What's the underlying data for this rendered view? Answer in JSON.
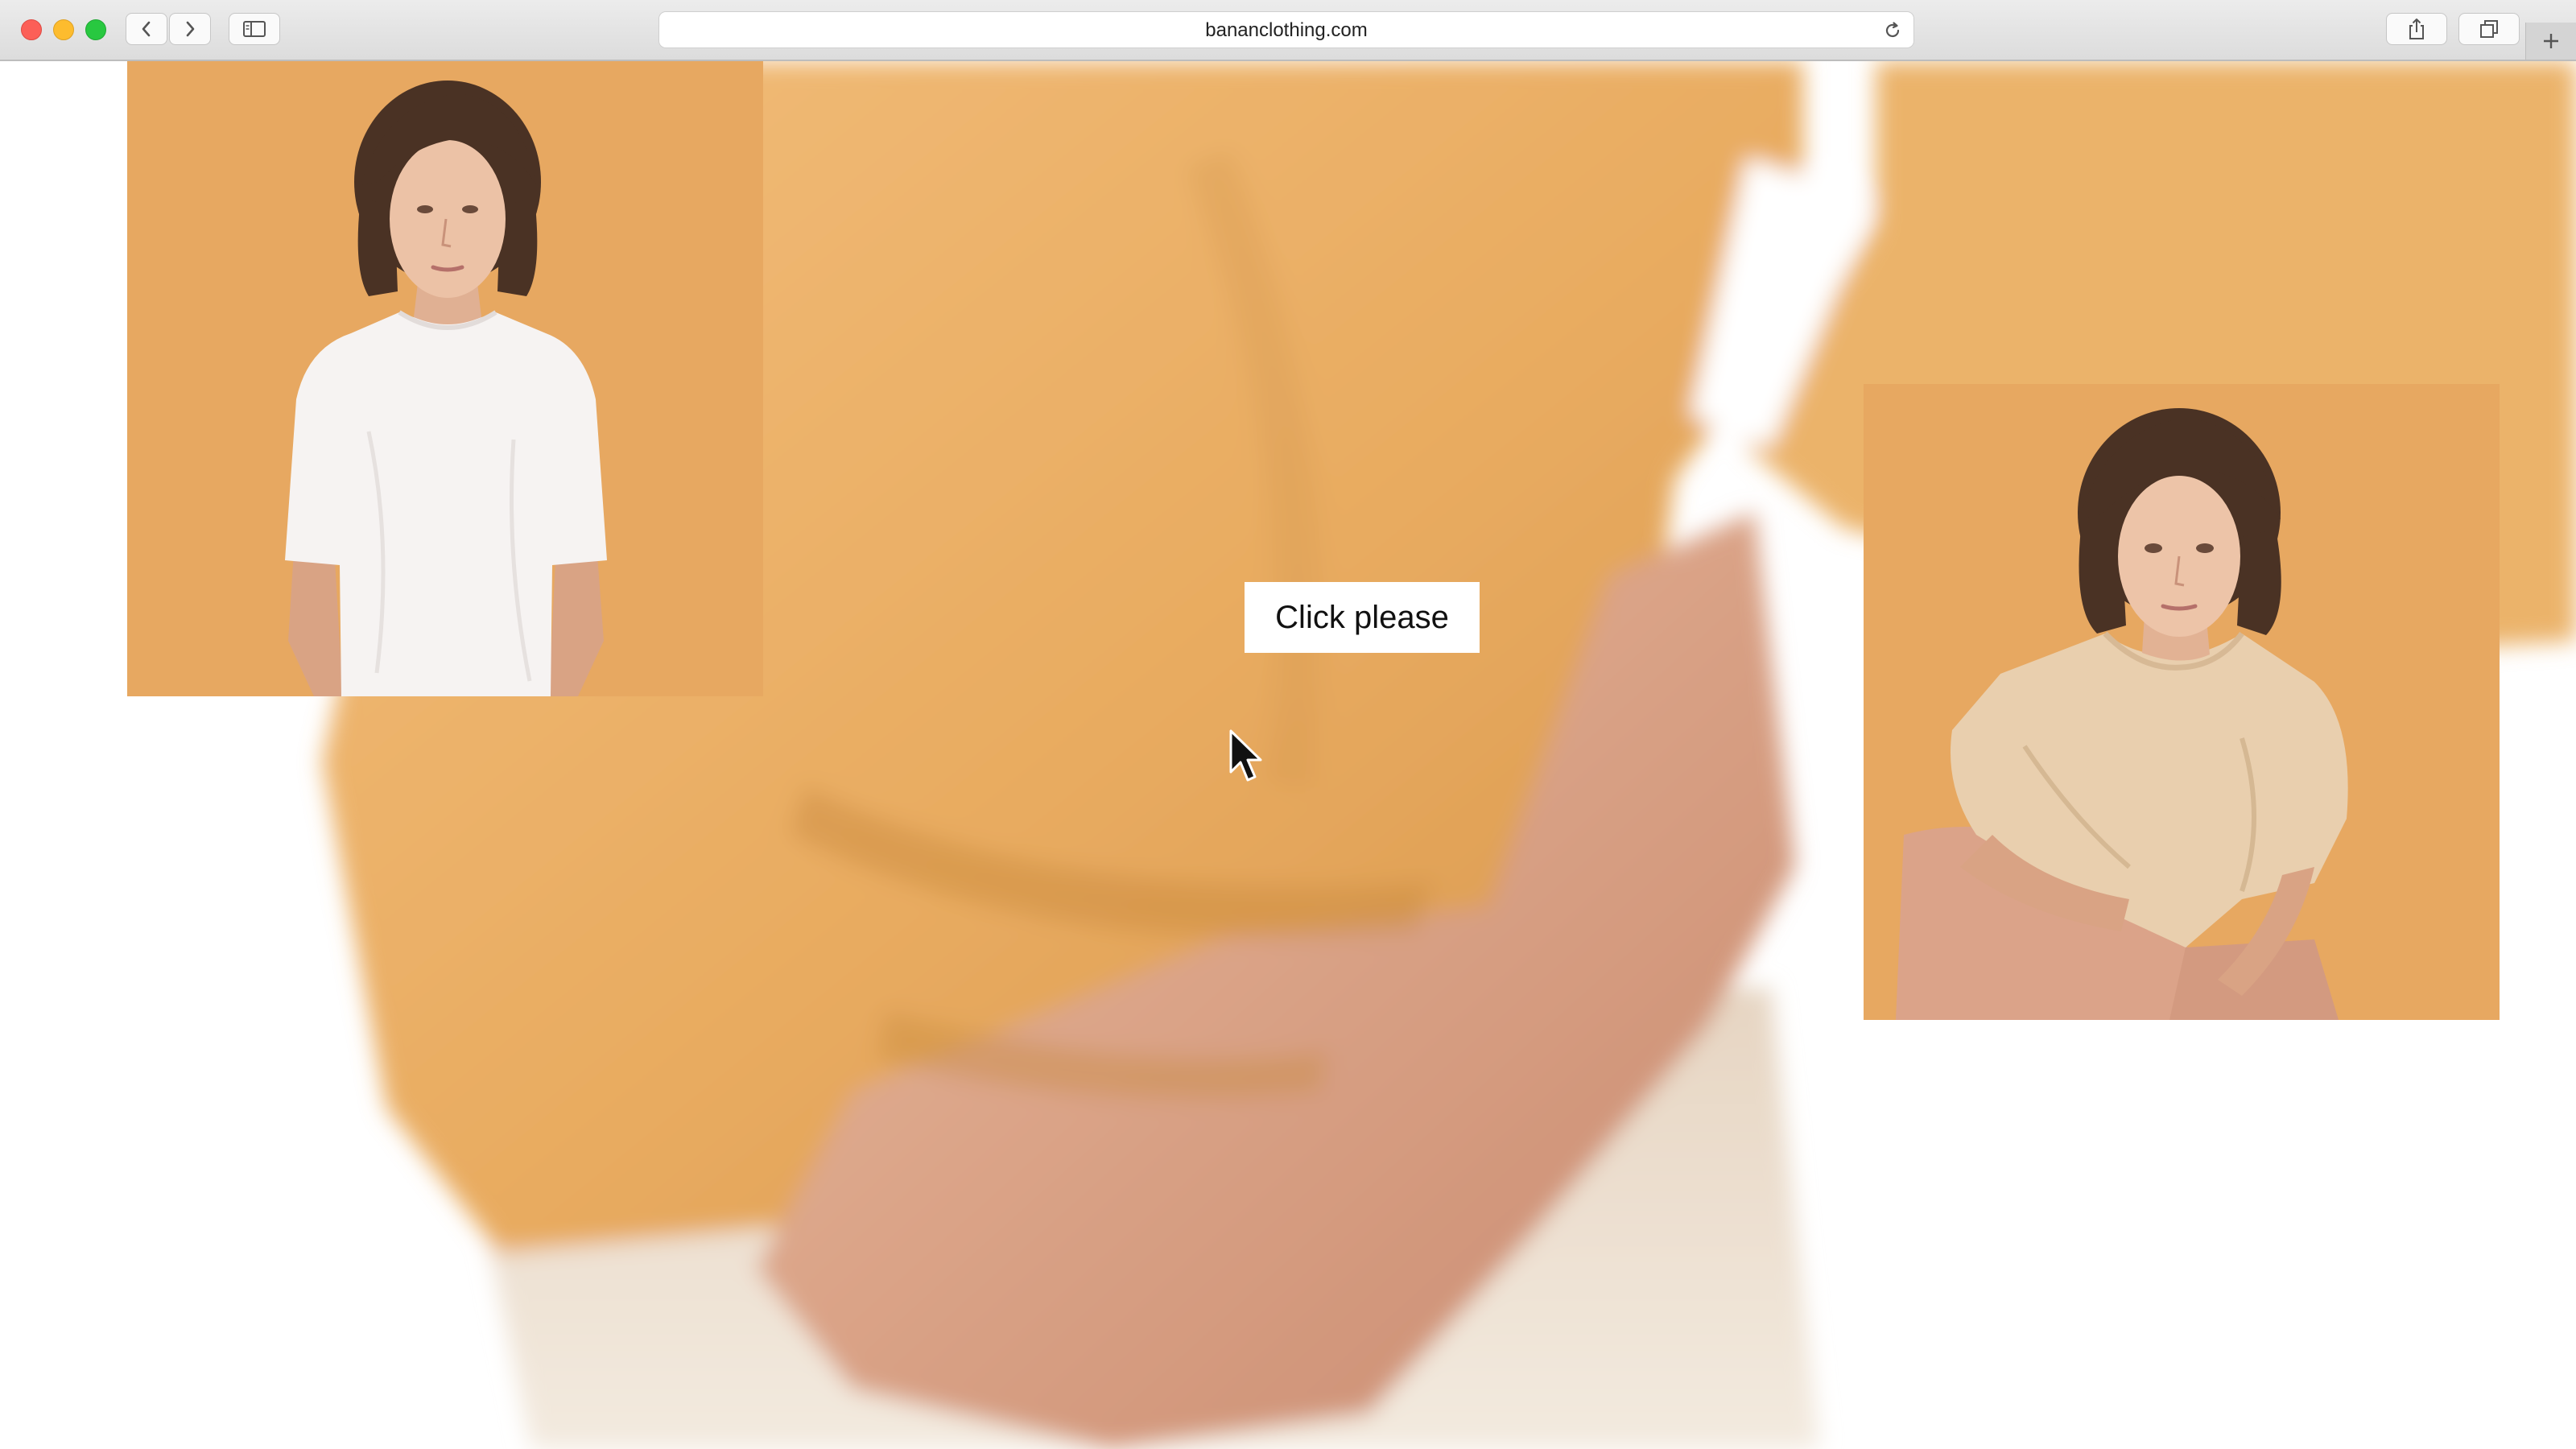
{
  "browser": {
    "url": "bananclothing.com",
    "icons": {
      "back": "chevron-left-icon",
      "forward": "chevron-right-icon",
      "sidebar": "sidebar-icon",
      "reload": "reload-icon",
      "share": "share-icon",
      "tabs": "tabs-overview-icon",
      "new_tab": "plus-icon"
    }
  },
  "page": {
    "cta_label": "Click please",
    "photos": [
      {
        "subject": "model in white t-shirt, standing",
        "background_color": "#e7a861"
      },
      {
        "subject": "model in beige t-shirt, crouching",
        "background_color": "#e7a861"
      }
    ],
    "background_photo": "close-up of orange t-shirt and hand on hip"
  },
  "colors": {
    "accent_orange": "#e7a861",
    "page_background": "#ffffff"
  }
}
